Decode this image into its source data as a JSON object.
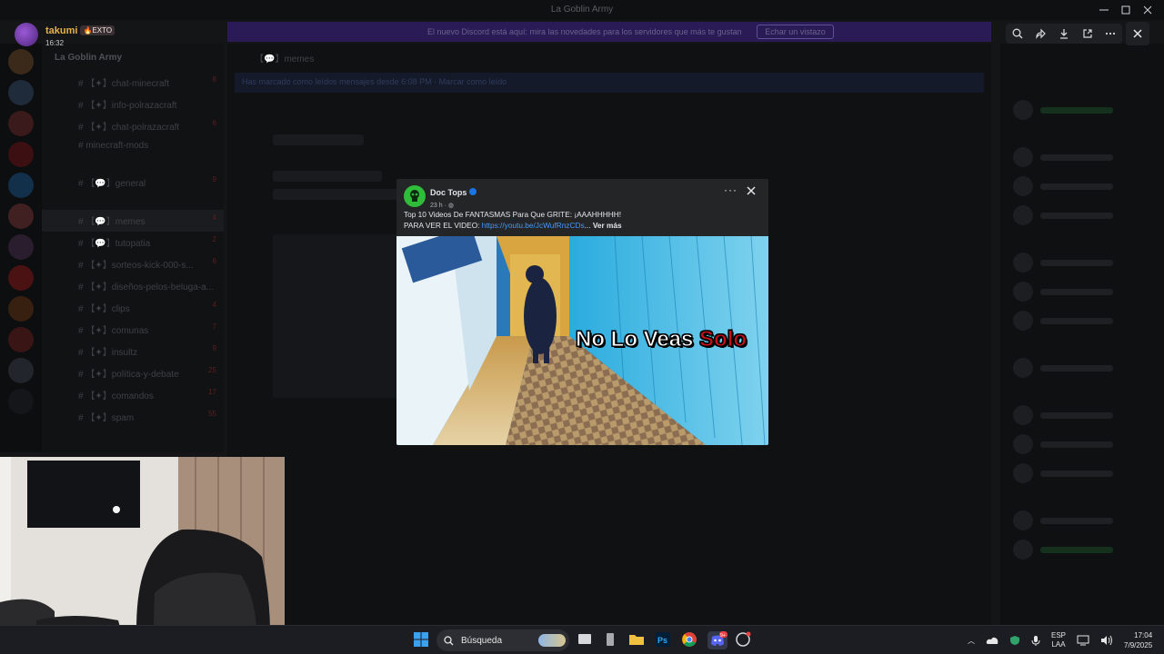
{
  "background": {
    "window_title": "La Goblin Army",
    "banner_text": "El nuevo Discord está aquí: mira las novedades para los servidores que más te gustan",
    "banner_button": "Echar un vistazo",
    "server_name": "La Goblin Army",
    "channels": [
      {
        "label": "# 【✦】chat-minecraft",
        "count": "8"
      },
      {
        "label": "# 【✦】info-polrazacraft",
        "count": ""
      },
      {
        "label": "# 【✦】chat-polrazacraft",
        "count": "6"
      },
      {
        "label": "# minecraft-mods",
        "count": ""
      },
      {
        "label": "# 【💬】general",
        "count": "9"
      },
      {
        "label": "# 【💬】memes",
        "count": "4"
      },
      {
        "label": "# 【💬】tutopatia",
        "count": "2"
      },
      {
        "label": "# 【✦】sorteos-kick-000-s...",
        "count": "6"
      },
      {
        "label": "# 【✦】diseños-pelos-beluga-a...",
        "count": ""
      },
      {
        "label": "# 【✦】clips",
        "count": "4"
      },
      {
        "label": "# 【✦】comunas",
        "count": "7"
      },
      {
        "label": "# 【✦】insultz",
        "count": "9"
      },
      {
        "label": "# 【✦】política-y-debate",
        "count": "25"
      },
      {
        "label": "# 【✦】comandos",
        "count": "17"
      },
      {
        "label": "# 【✦】spam",
        "count": "55"
      }
    ],
    "chat_header": "【💬】memes",
    "chat_notice": "Has marcado como leídos mensajes desde 6:08 PM",
    "chat_notice_action": "Marcar como leído"
  },
  "viewer": {
    "user_name": "takumi",
    "user_badge": "🔥EXTO",
    "time": "16:32",
    "tools": [
      "zoom-in-icon",
      "forward-icon",
      "download-icon",
      "open-external-icon",
      "more-icon"
    ]
  },
  "post": {
    "page_name": "Doc Tops",
    "age": "23 h ·",
    "line1": "Top 10 Videos De FANTASMAS Para Que GRITE: ¡AAAHHHHH!",
    "line2_prefix": "PARA VER EL VIDEO: ",
    "link": "https://youtu.be/JcWufRnzCDs",
    "ellipsis": "...",
    "see_more": "Ver más",
    "overlay_white": "No Lo Veas",
    "overlay_red": "Solo"
  },
  "taskbar": {
    "search_label": "Búsqueda",
    "lang_top": "ESP",
    "lang_bottom": "LAA",
    "clock_time": "17:04",
    "clock_date": "7/9/2025",
    "discord_badge": "9+"
  },
  "colors": {
    "accent_link": "#4599ff",
    "facebook_blue": "#1b74e4",
    "overlay_red": "#c8101a",
    "page_avatar_green": "#2fbd3a"
  }
}
